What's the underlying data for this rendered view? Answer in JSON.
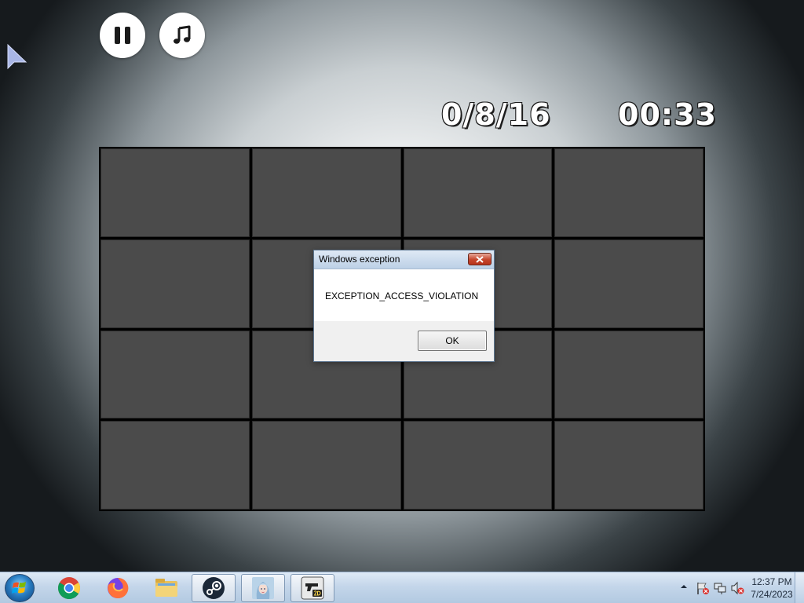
{
  "game": {
    "score": "0/8/16",
    "timer": "00:33",
    "board": {
      "rows": 4,
      "columns": 4,
      "cards_face_down": 16
    },
    "pause_button_icon": "pause-icon",
    "music_button_icon": "music-note-icon",
    "card_color": "#4b4b4b"
  },
  "dialog": {
    "title": "Windows exception",
    "message": "EXCEPTION_ACCESS_VIOLATION",
    "ok_label": "OK"
  },
  "taskbar": {
    "start_icon": "windows-start-icon",
    "apps": [
      {
        "name": "chrome",
        "icon": "chrome-icon",
        "active": false
      },
      {
        "name": "firefox",
        "icon": "firefox-icon",
        "active": false
      },
      {
        "name": "file-explorer",
        "icon": "folder-icon",
        "active": false
      },
      {
        "name": "steam",
        "icon": "steam-icon",
        "active": true
      },
      {
        "name": "game-anime",
        "icon": "anime-girl-icon",
        "active": true
      },
      {
        "name": "game-2d",
        "icon": "2d-game-icon",
        "active": true
      }
    ],
    "clock": {
      "time": "12:37 PM",
      "date": "7/24/2023"
    }
  }
}
